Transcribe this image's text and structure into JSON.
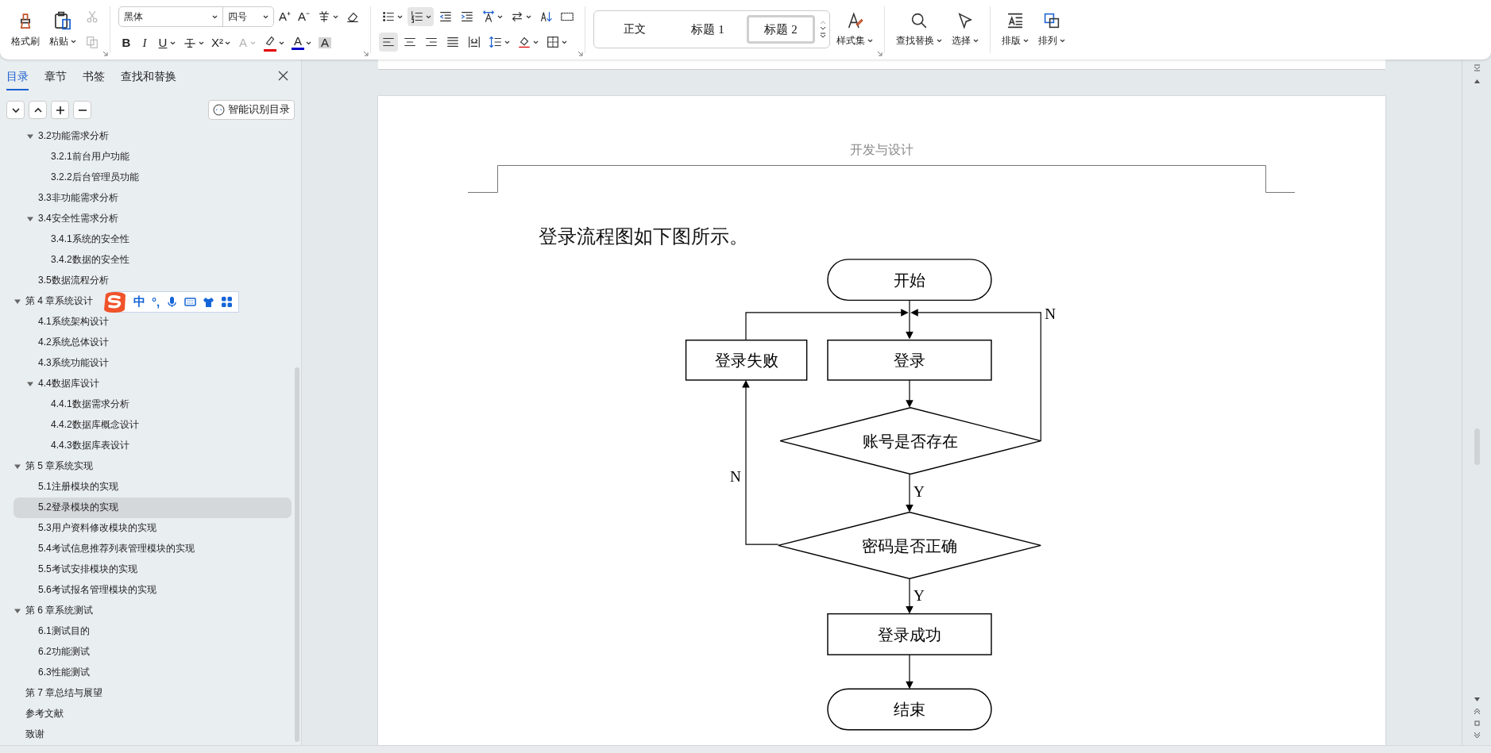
{
  "toolbar": {
    "clipboard": {
      "buttons": [
        {
          "kind": "brush",
          "label": "格式刷",
          "has_menu": false
        },
        {
          "kind": "paste",
          "label": "粘贴",
          "has_menu": true
        }
      ],
      "small": [
        {
          "kind": "cut",
          "disabled": true
        },
        {
          "kind": "copy",
          "disabled": true
        }
      ]
    },
    "font": {
      "name": "黑体",
      "size": "四号",
      "row1": [
        {
          "kind": "glyph",
          "glyph": "A⁺"
        },
        {
          "kind": "glyph",
          "glyph": "A⁻"
        },
        {
          "kind": "pinyin",
          "has_menu": true
        },
        {
          "kind": "eraser"
        }
      ],
      "row2": [
        {
          "kind": "bold",
          "glyph": "B"
        },
        {
          "kind": "italic",
          "glyph": "I"
        },
        {
          "kind": "underline",
          "glyph": "U",
          "has_menu": true
        },
        {
          "kind": "strike",
          "has_menu": true
        },
        {
          "kind": "glyph",
          "glyph": "X²",
          "has_menu": true
        },
        {
          "kind": "glyph",
          "glyph": "A",
          "disabled": true,
          "has_menu": true
        },
        {
          "kind": "highlight",
          "color": "#e00000",
          "has_menu": true
        },
        {
          "kind": "glyph",
          "glyph": "A",
          "color": "#0000c8",
          "has_menu": true
        },
        {
          "kind": "shaded",
          "glyph": "A"
        }
      ]
    },
    "paragraph": {
      "row1": [
        {
          "kind": "bullets",
          "selected": false,
          "has_menu": true
        },
        {
          "kind": "numbering",
          "selected": true,
          "has_menu": true
        },
        {
          "kind": "outdent",
          "selected": false
        },
        {
          "kind": "indent",
          "selected": false
        },
        {
          "kind": "direction",
          "selected": false,
          "has_menu": true
        },
        {
          "kind": "swap",
          "selected": false,
          "has_menu": true
        },
        {
          "kind": "sort",
          "selected": false
        },
        {
          "kind": "grid",
          "selected": false
        }
      ],
      "row2": [
        {
          "kind": "left",
          "selected": true
        },
        {
          "kind": "center",
          "selected": false
        },
        {
          "kind": "right",
          "selected": false
        },
        {
          "kind": "justify",
          "selected": false
        },
        {
          "kind": "distribute",
          "selected": false
        },
        {
          "kind": "spacing",
          "selected": false,
          "has_menu": true
        },
        {
          "kind": "fill",
          "selected": false,
          "has_menu": true
        },
        {
          "kind": "border",
          "selected": false,
          "has_menu": true
        }
      ]
    },
    "styles": [
      {
        "label": "正文",
        "selected": false
      },
      {
        "label": "标题 1",
        "selected": false
      },
      {
        "label": "标题 2",
        "selected": true
      }
    ],
    "tools": [
      {
        "kind": "styleset",
        "label": "样式集",
        "has_menu": true
      },
      {
        "kind": "find",
        "label": "查找替换",
        "has_menu": true
      },
      {
        "kind": "select",
        "label": "选择",
        "has_menu": true
      },
      {
        "kind": "layout",
        "label": "排版",
        "has_menu": true
      },
      {
        "kind": "arrange",
        "label": "排列",
        "has_menu": true
      }
    ]
  },
  "sidebar": {
    "tabs": [
      {
        "label": "目录",
        "selected": true
      },
      {
        "label": "章节",
        "selected": false
      },
      {
        "label": "书签",
        "selected": false
      },
      {
        "label": "查找和替换",
        "selected": false
      }
    ],
    "smart_button": "智能识别目录",
    "toc": {
      "continued": [
        {
          "label": "3.2功能需求分析",
          "selected": false,
          "expanded": true,
          "children": [
            {
              "label": "3.2.1前台用户功能",
              "selected": false
            },
            {
              "label": "3.2.2后台管理员功能",
              "selected": false
            }
          ]
        },
        {
          "label": "3.3非功能需求分析",
          "selected": false
        },
        {
          "label": "3.4安全性需求分析",
          "selected": false,
          "expanded": true,
          "children": [
            {
              "label": "3.4.1系统的安全性",
              "selected": false
            },
            {
              "label": "3.4.2数据的安全性",
              "selected": false
            }
          ]
        },
        {
          "label": "3.5数据流程分析",
          "selected": false
        }
      ],
      "items": [
        {
          "label": "第 4 章系统设计",
          "selected": false,
          "expanded": true,
          "children": [
            {
              "label": "4.1系统架构设计",
              "selected": false
            },
            {
              "label": "4.2系统总体设计",
              "selected": false
            },
            {
              "label": "4.3系统功能设计",
              "selected": false
            },
            {
              "label": "4.4数据库设计",
              "selected": false,
              "expanded": true,
              "children": [
                {
                  "label": "4.4.1数据需求分析",
                  "selected": false
                },
                {
                  "label": "4.4.2数据库概念设计",
                  "selected": false
                },
                {
                  "label": "4.4.3数据库表设计",
                  "selected": false
                }
              ]
            }
          ]
        },
        {
          "label": "第 5 章系统实现",
          "selected": false,
          "expanded": true,
          "children": [
            {
              "label": "5.1注册模块的实现",
              "selected": false
            },
            {
              "label": "5.2登录模块的实现",
              "selected": true
            },
            {
              "label": "5.3用户资料修改模块的实现",
              "selected": false
            },
            {
              "label": "5.4考试信息推荐列表管理模块的实现",
              "selected": false
            },
            {
              "label": "5.5考试安排模块的实现",
              "selected": false
            },
            {
              "label": "5.6考试报名管理模块的实现",
              "selected": false
            }
          ]
        },
        {
          "label": "第 6 章系统测试",
          "selected": false,
          "expanded": true,
          "children": [
            {
              "label": "6.1测试目的",
              "selected": false
            },
            {
              "label": "6.2功能测试",
              "selected": false
            },
            {
              "label": "6.3性能测试",
              "selected": false
            }
          ]
        },
        {
          "label": "第 7 章总结与展望",
          "selected": false
        },
        {
          "label": "参考文献",
          "selected": false
        },
        {
          "label": "致谢",
          "selected": false
        }
      ]
    }
  },
  "ime": {
    "mode": "中",
    "punctuation": "°,"
  },
  "document": {
    "header": "开发与设计",
    "paragraph": "登录流程图如下图所示。",
    "flowchart": {
      "nodes": [
        {
          "kind": "terminal",
          "label": "开始"
        },
        {
          "kind": "process",
          "label": "登录失败"
        },
        {
          "kind": "process",
          "label": "登录"
        },
        {
          "kind": "decision",
          "label": "账号是否存在"
        },
        {
          "kind": "decision",
          "label": "密码是否正确"
        },
        {
          "kind": "process",
          "label": "登录成功"
        },
        {
          "kind": "terminal",
          "label": "结束"
        }
      ],
      "edge_labels": [
        "N",
        "N",
        "Y",
        "Y"
      ]
    }
  }
}
